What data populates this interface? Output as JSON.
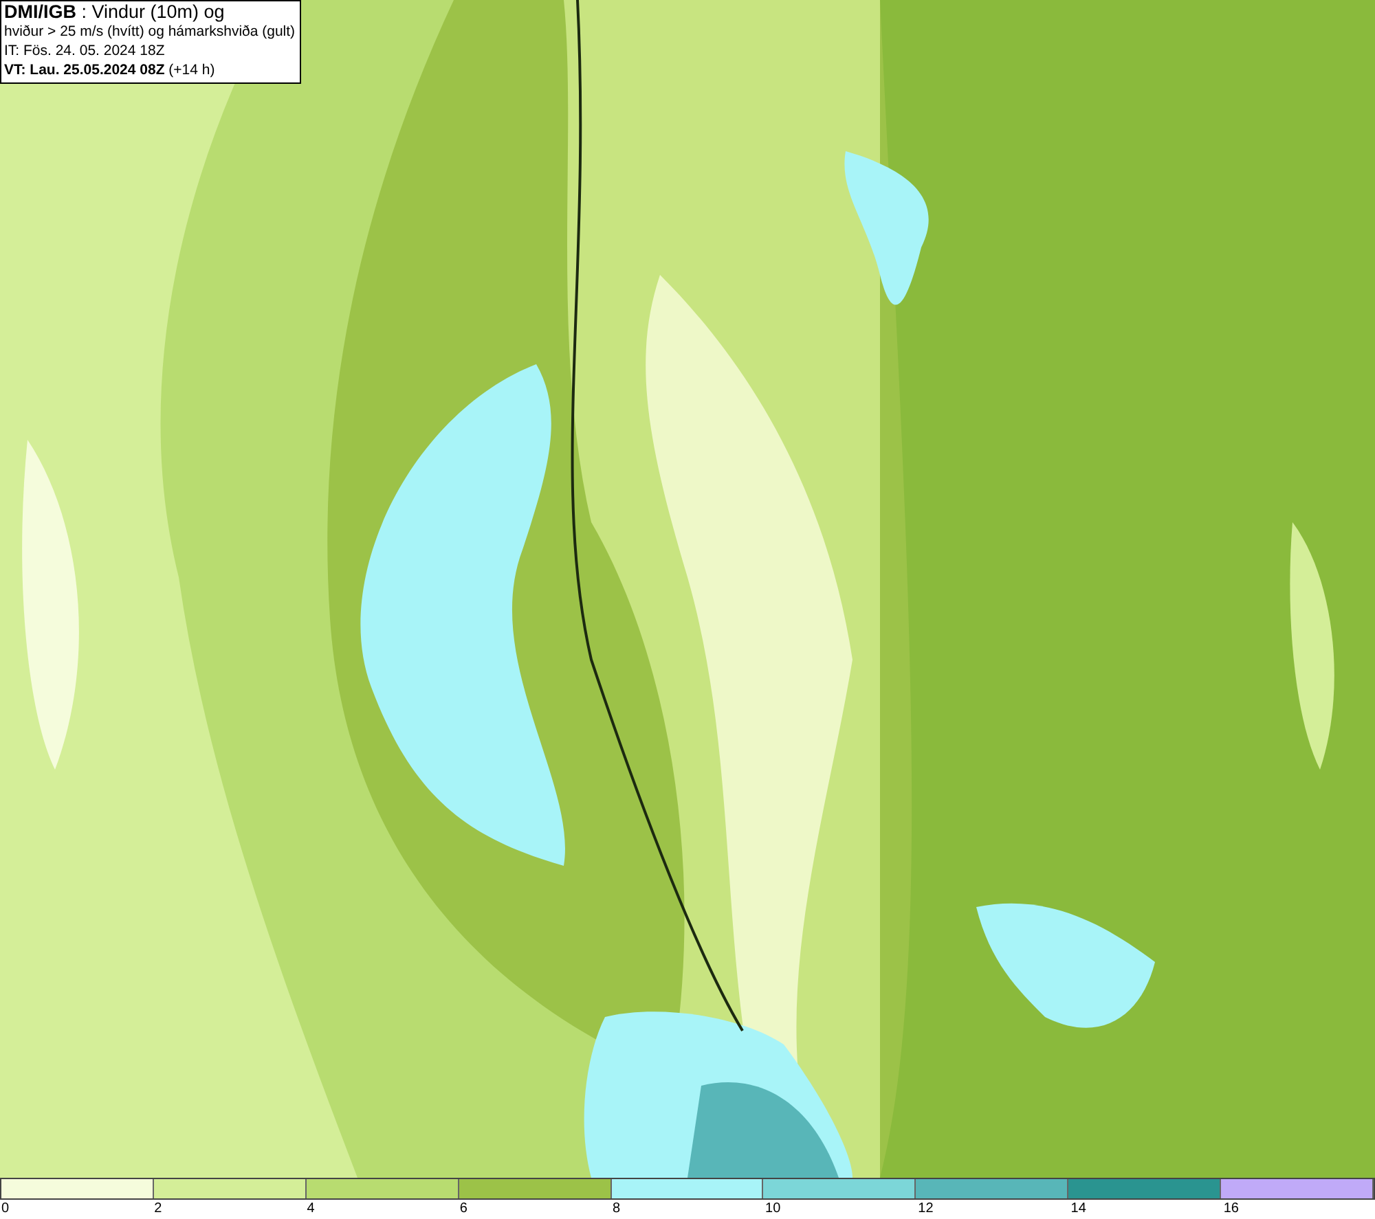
{
  "header": {
    "lines": [
      "**DMI/IGB** : Vindur (10m) og",
      "hviður > 25 m/s (hvítt) og hámarkshviða (gult)",
      "IT: Fös. 24. 05. 2024 18Z",
      "**VT: Lau. 25.05.2024 08Z** (+14 h)"
    ]
  },
  "legend": {
    "segments": [
      {
        "color": "#f5fcdc"
      },
      {
        "color": "#d4ee98"
      },
      {
        "color": "#b8dc70"
      },
      {
        "color": "#9cc248"
      },
      {
        "color": "#a8f4f8"
      },
      {
        "color": "#7cd6d8"
      },
      {
        "color": "#58b6b8"
      },
      {
        "color": "#2a9490"
      },
      {
        "color": "#c0aaf8"
      }
    ],
    "ticks": [
      "0",
      "2",
      "4",
      "6",
      "8",
      "10",
      "12",
      "14",
      "16"
    ]
  }
}
